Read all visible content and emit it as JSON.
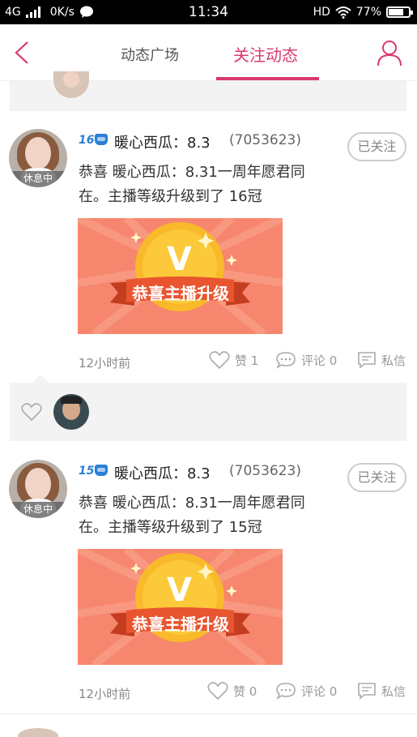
{
  "status_bar": {
    "network": "4G",
    "speed": "0K/s",
    "time": "11:34",
    "hd": "HD",
    "battery": "77%",
    "battery_level": 0.77
  },
  "header": {
    "tabs": [
      "动态广场",
      "关注动态"
    ],
    "active_tab": "关注动态"
  },
  "posts": [
    {
      "level": "16",
      "name": "暖心西瓜：8.3",
      "uid": "(7053623)",
      "follow_label": "已关注",
      "avatar_label": "休息中",
      "text_line1": "恭喜 暖心西瓜：8.31一周年愿君同",
      "text_line2": "在。主播等级升级到了 16冠",
      "banner_letter": "V",
      "banner_text": "恭喜主播升级",
      "time": "12小时前",
      "like_label": "赞 1",
      "comment_label": "评论 0",
      "message_label": "私信"
    },
    {
      "level": "15",
      "name": "暖心西瓜：8.3",
      "uid": "(7053623)",
      "follow_label": "已关注",
      "avatar_label": "休息中",
      "text_line1": "恭喜 暖心西瓜：8.31一周年愿君同",
      "text_line2": "在。主播等级升级到了 15冠",
      "banner_letter": "V",
      "banner_text": "恭喜主播升级",
      "time": "12小时前",
      "like_label": "赞 0",
      "comment_label": "评论 0",
      "message_label": "私信"
    }
  ],
  "colors": {
    "accent": "#d9396b",
    "level_blue": "#2a7fd6",
    "banner_bg": "#f7866f",
    "ribbon": "#e8552f",
    "coin": "#f8b92a"
  }
}
